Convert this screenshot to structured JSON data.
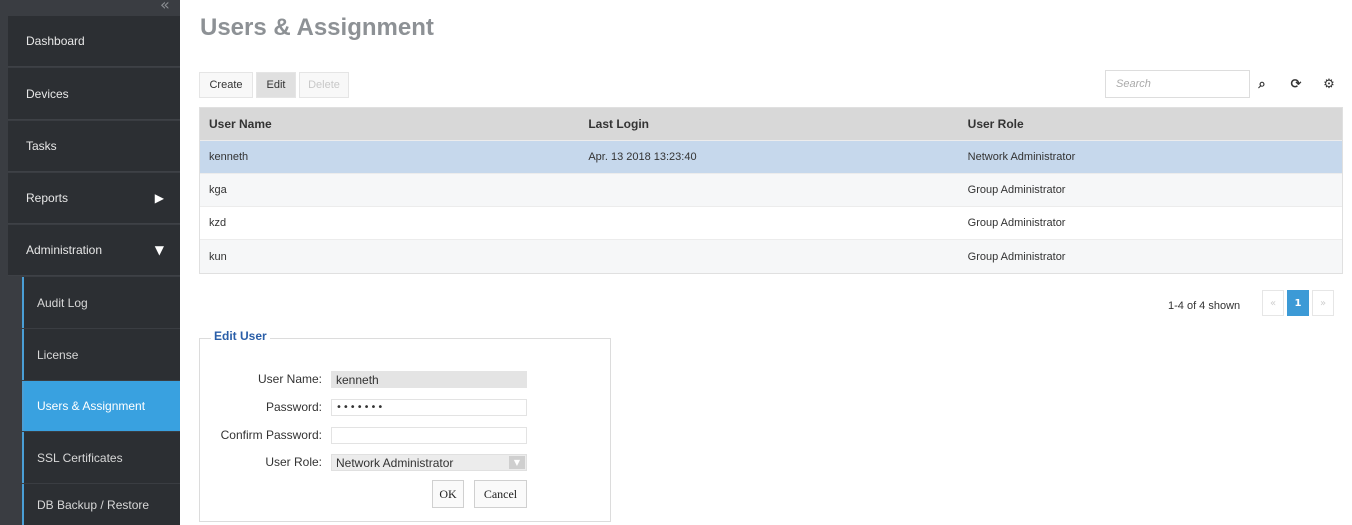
{
  "sidebar": {
    "collapse_icon": "double-chevron-left-icon",
    "items": [
      {
        "label": "Dashboard"
      },
      {
        "label": "Devices"
      },
      {
        "label": "Tasks"
      },
      {
        "label": "Reports",
        "arrow": "▶"
      },
      {
        "label": "Administration",
        "arrow": "▼"
      }
    ],
    "subitems": [
      {
        "label": "Audit Log"
      },
      {
        "label": "License"
      },
      {
        "label": "Users & Assignment",
        "active": true
      },
      {
        "label": "SSL Certificates"
      },
      {
        "label": "DB Backup / Restore"
      }
    ]
  },
  "page": {
    "title": "Users & Assignment"
  },
  "toolbar": {
    "create_label": "Create",
    "edit_label": "Edit",
    "delete_label": "Delete",
    "search_placeholder": "Search",
    "search_icon": "search-icon",
    "refresh_icon": "refresh-icon",
    "settings_icon": "gear-icon"
  },
  "table": {
    "columns": [
      "User Name",
      "Last Login",
      "User Role"
    ],
    "rows": [
      {
        "name": "kenneth",
        "last_login": "Apr. 13 2018 13:23:40",
        "role": "Network Administrator",
        "selected": true
      },
      {
        "name": "kga",
        "last_login": "",
        "role": "Group Administrator"
      },
      {
        "name": "kzd",
        "last_login": "",
        "role": "Group Administrator"
      },
      {
        "name": "kun",
        "last_login": "",
        "role": "Group Administrator"
      }
    ]
  },
  "pager": {
    "shown_text": "1-4 of 4 shown",
    "prev": "«",
    "current": "1",
    "next": "»"
  },
  "edit_form": {
    "legend": "Edit User",
    "username_label": "User Name:",
    "username_value": "kenneth",
    "password_label": "Password:",
    "password_value": "•••••••",
    "confirm_label": "Confirm Password:",
    "confirm_value": "",
    "role_label": "User Role:",
    "role_value": "Network Administrator",
    "ok_label": "OK",
    "cancel_label": "Cancel"
  },
  "colors": {
    "sidebar_bg": "#2c2f33",
    "active_item": "#39a1e0",
    "selected_row": "#c6d8ec",
    "pager_active": "#3c9ad6",
    "legend": "#2a5ea8"
  }
}
